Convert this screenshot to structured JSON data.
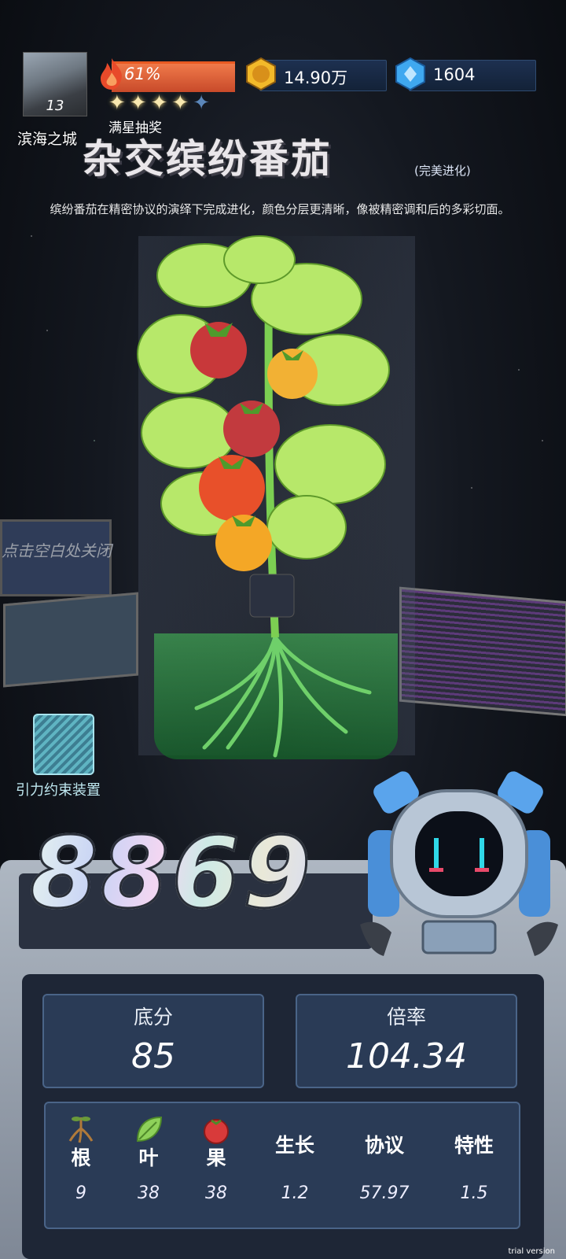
{
  "hud": {
    "avatar_level": "13",
    "city_name": "滨海之城",
    "heat_percent": "61%",
    "stars_filled": 4,
    "stars_total": 5,
    "full_star_label": "满星抽奖",
    "gold_amount": "14.90万",
    "gem_amount": "1604"
  },
  "title": {
    "name": "杂交缤纷番茄",
    "tag": "(完美进化)",
    "description": "缤纷番茄在精密协议的演绎下完成进化，颜色分层更清晰，像被精密调和后的多彩切面。"
  },
  "hints": {
    "close": "点击空白处关闭",
    "device_label": "引力约束装置"
  },
  "score": {
    "total": "8869",
    "base_label": "底分",
    "base_value": "85",
    "multiplier_label": "倍率",
    "multiplier_value": "104.34"
  },
  "stats": [
    {
      "label": "根",
      "value": "9",
      "icon": "root-icon"
    },
    {
      "label": "叶",
      "value": "38",
      "icon": "leaf-icon"
    },
    {
      "label": "果",
      "value": "38",
      "icon": "fruit-icon"
    },
    {
      "label": "生长",
      "value": "1.2"
    },
    {
      "label": "协议",
      "value": "57.97"
    },
    {
      "label": "特性",
      "value": "1.5"
    }
  ],
  "watermark": "trial version",
  "colors": {
    "heat": "#e8653a",
    "panel_blue": "#2a3b56",
    "accent_cyan": "#bfe8f0"
  }
}
